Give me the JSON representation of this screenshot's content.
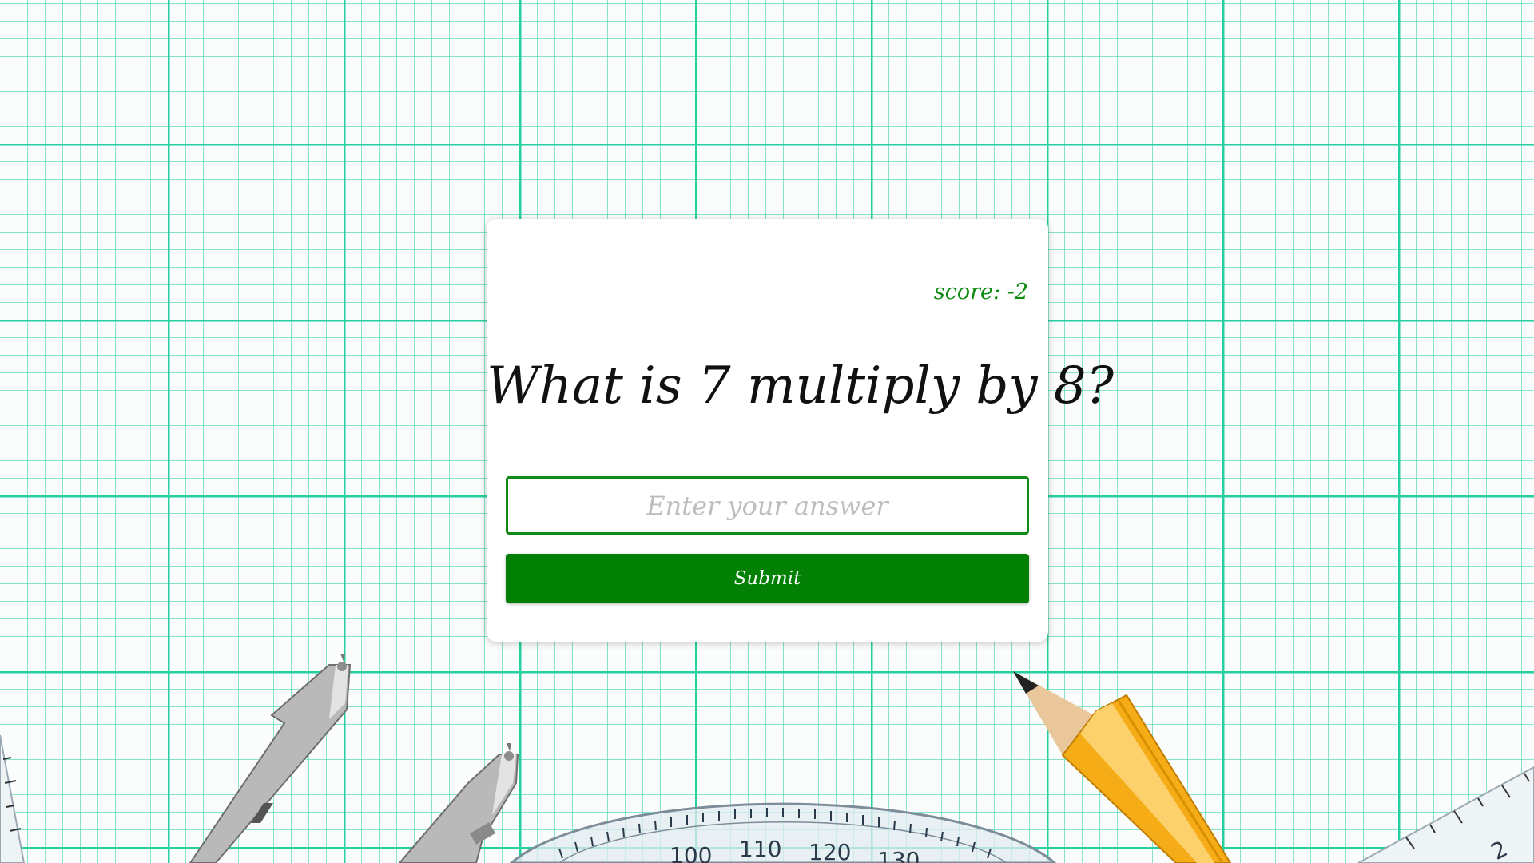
{
  "quiz": {
    "score_text": "score: -2",
    "question": "What is 7 multiply by 8?",
    "input_placeholder": "Enter your answer",
    "submit_label": "Submit"
  },
  "protractor": {
    "labels": [
      "100",
      "110",
      "120",
      "130"
    ]
  },
  "ruler": {
    "label": "2"
  },
  "colors": {
    "grid": "#25cfa0",
    "accent_green": "#028003",
    "score_green": "#0d8a12",
    "pencil_yellow": "#f7b21c"
  },
  "icons": [
    "compass-icon",
    "pencil-icon",
    "protractor-icon",
    "ruler-icon"
  ]
}
